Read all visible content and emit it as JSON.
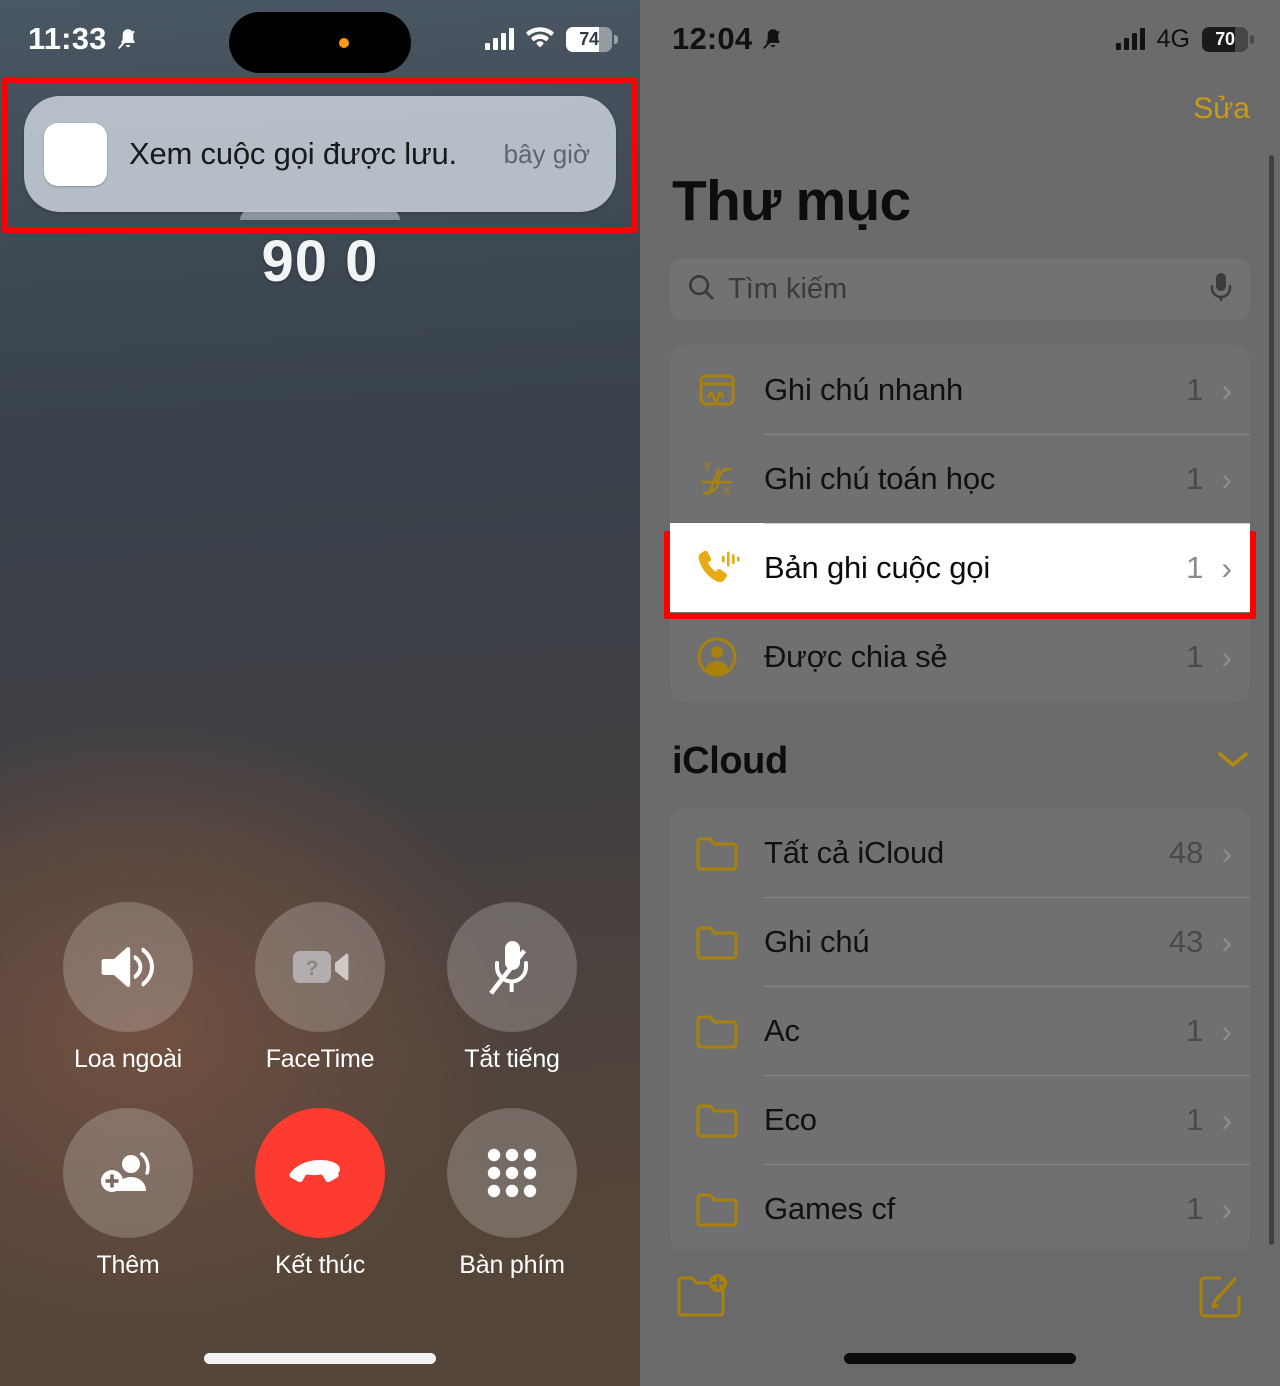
{
  "left_phone": {
    "status_bar": {
      "time": "11:33",
      "silent_icon": "bell-slash-icon",
      "signal_icon": "cellular-bars-icon",
      "wifi_icon": "wifi-icon",
      "battery_level": "74"
    },
    "notification": {
      "app_icon": "notes-app-icon",
      "message": "Xem cuộc gọi được lưu.",
      "time": "bây giờ",
      "highlight_color": "#fe0000"
    },
    "call": {
      "number": "90 0"
    },
    "controls": [
      {
        "id": "speaker",
        "icon": "speaker-wave-icon",
        "label": "Loa ngoài"
      },
      {
        "id": "facetime",
        "icon": "video-question-icon",
        "label": "FaceTime"
      },
      {
        "id": "mute",
        "icon": "mic-slash-icon",
        "label": "Tắt tiếng"
      },
      {
        "id": "add",
        "icon": "add-contact-icon",
        "label": "Thêm"
      },
      {
        "id": "end",
        "icon": "end-call-icon",
        "label": "Kết thúc"
      },
      {
        "id": "keypad",
        "icon": "keypad-icon",
        "label": "Bàn phím"
      }
    ],
    "end_call_color": "#fe3b30"
  },
  "right_phone": {
    "status_bar": {
      "time": "12:04",
      "silent_icon": "bell-slash-icon",
      "signal_icon": "cellular-bars-icon",
      "network": "4G",
      "battery_level": "70"
    },
    "edit_button": "Sửa",
    "page_title": "Thư mục",
    "search": {
      "icon": "search-icon",
      "placeholder": "Tìm kiếm",
      "mic_icon": "microphone-icon"
    },
    "system_folders": [
      {
        "icon": "quick-note-icon",
        "label": "Ghi chú nhanh",
        "count": "1",
        "chevron": "›",
        "highlighted": false
      },
      {
        "icon": "math-note-icon",
        "label": "Ghi chú toán học",
        "count": "1",
        "chevron": "›",
        "highlighted": false
      },
      {
        "icon": "call-record-icon",
        "label": "Bản ghi cuộc gọi",
        "count": "1",
        "chevron": "›",
        "highlighted": true
      },
      {
        "icon": "shared-icon",
        "label": "Được chia sẻ",
        "count": "1",
        "chevron": "›",
        "highlighted": false
      }
    ],
    "icloud_section": {
      "title": "iCloud",
      "collapse_icon": "chevron-down-icon"
    },
    "icloud_folders": [
      {
        "icon": "folder-icon",
        "label": "Tất cả iCloud",
        "count": "48",
        "chevron": "›"
      },
      {
        "icon": "folder-icon",
        "label": "Ghi chú",
        "count": "43",
        "chevron": "›"
      },
      {
        "icon": "folder-icon",
        "label": "Ac",
        "count": "1",
        "chevron": "›"
      },
      {
        "icon": "folder-icon",
        "label": "Eco",
        "count": "1",
        "chevron": "›"
      },
      {
        "icon": "folder-icon",
        "label": "Games cf",
        "count": "1",
        "chevron": "›"
      }
    ],
    "bottom_bar": {
      "new_folder_icon": "new-folder-icon",
      "compose_icon": "compose-note-icon"
    },
    "accent_color": "#c79a18",
    "highlight_color": "#fe0000"
  }
}
